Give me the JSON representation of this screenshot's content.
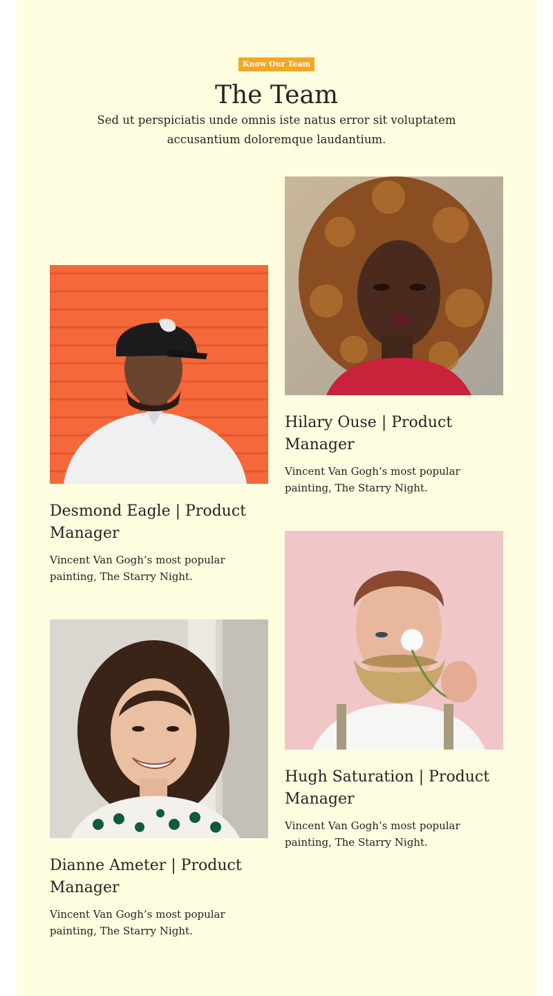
{
  "section": {
    "badge": "Know Our Team",
    "title": "The Team",
    "intro": "Sed ut perspiciatis unde omnis iste natus error sit voluptatem accusantium doloremque laudantium."
  },
  "members": [
    {
      "name": "Desmond Eagle  |  Product Manager",
      "description": "Vincent Van Gogh’s most popular painting, The Starry Night."
    },
    {
      "name": "Hilary Ouse  |  Product Manager",
      "description": "Vincent Van Gogh’s most popular painting, The Starry Night."
    },
    {
      "name": "Dianne Ameter  |  Product Manager",
      "description": "Vincent Van Gogh’s most popular painting, The Starry Night."
    },
    {
      "name": "Hugh Saturation  |  Product Manager",
      "description": "Vincent Van Gogh’s most popular painting, The Starry Night."
    }
  ],
  "colors": {
    "background": "#fffddf",
    "badge": "#f5a623",
    "text": "#232323"
  }
}
